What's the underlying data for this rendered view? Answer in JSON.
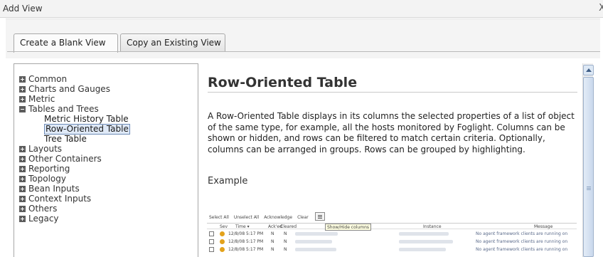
{
  "window": {
    "title": "Add View",
    "close_glyph": "X"
  },
  "tabs": [
    {
      "label": "Create a Blank View",
      "active": true
    },
    {
      "label": "Copy an Existing View",
      "active": false
    }
  ],
  "tree": {
    "items": [
      {
        "label": "Common",
        "state": "collapsed"
      },
      {
        "label": "Charts and Gauges",
        "state": "collapsed"
      },
      {
        "label": "Metric",
        "state": "collapsed"
      },
      {
        "label": "Tables and Trees",
        "state": "expanded"
      },
      {
        "label": "Layouts",
        "state": "collapsed"
      },
      {
        "label": "Other Containers",
        "state": "collapsed"
      },
      {
        "label": "Reporting",
        "state": "collapsed"
      },
      {
        "label": "Topology",
        "state": "collapsed"
      },
      {
        "label": "Bean Inputs",
        "state": "collapsed"
      },
      {
        "label": "Context Inputs",
        "state": "collapsed"
      },
      {
        "label": "Others",
        "state": "collapsed"
      },
      {
        "label": "Legacy",
        "state": "collapsed"
      }
    ],
    "children": [
      {
        "label": "Metric History Table",
        "selected": false
      },
      {
        "label": "Row-Oriented Table",
        "selected": true
      },
      {
        "label": "Tree Table",
        "selected": false
      }
    ]
  },
  "detail": {
    "heading": "Row-Oriented Table",
    "description": "A Row-Oriented Table displays in its columns the selected properties of a list of object of the same type, for example, all the hosts monitored by Foglight. Columns can be shown or hidden, and rows can be filtered to match certain criteria. Optionally, columns can be arranged in groups. Rows can be grouped by highlighting.",
    "example_label": "Example"
  },
  "preview": {
    "toolbar": [
      "Select All",
      "Unselect All",
      "Acknowledge",
      "Clear"
    ],
    "tooltip": "Show/Hide columns",
    "columns": [
      "Sev",
      "Time ▾",
      "Ack'ed",
      "Cleared",
      "Instance",
      "Message"
    ],
    "rows": [
      {
        "time": "12/8/08 5:17 PM",
        "acked": "N",
        "cleared": "N",
        "message": "No agent framework clients are running on"
      },
      {
        "time": "12/8/08 5:17 PM",
        "acked": "N",
        "cleared": "N",
        "message": "No agent framework clients are running on"
      },
      {
        "time": "12/8/08 5:17 PM",
        "acked": "N",
        "cleared": "N",
        "message": "No agent framework clients are running on"
      }
    ]
  }
}
